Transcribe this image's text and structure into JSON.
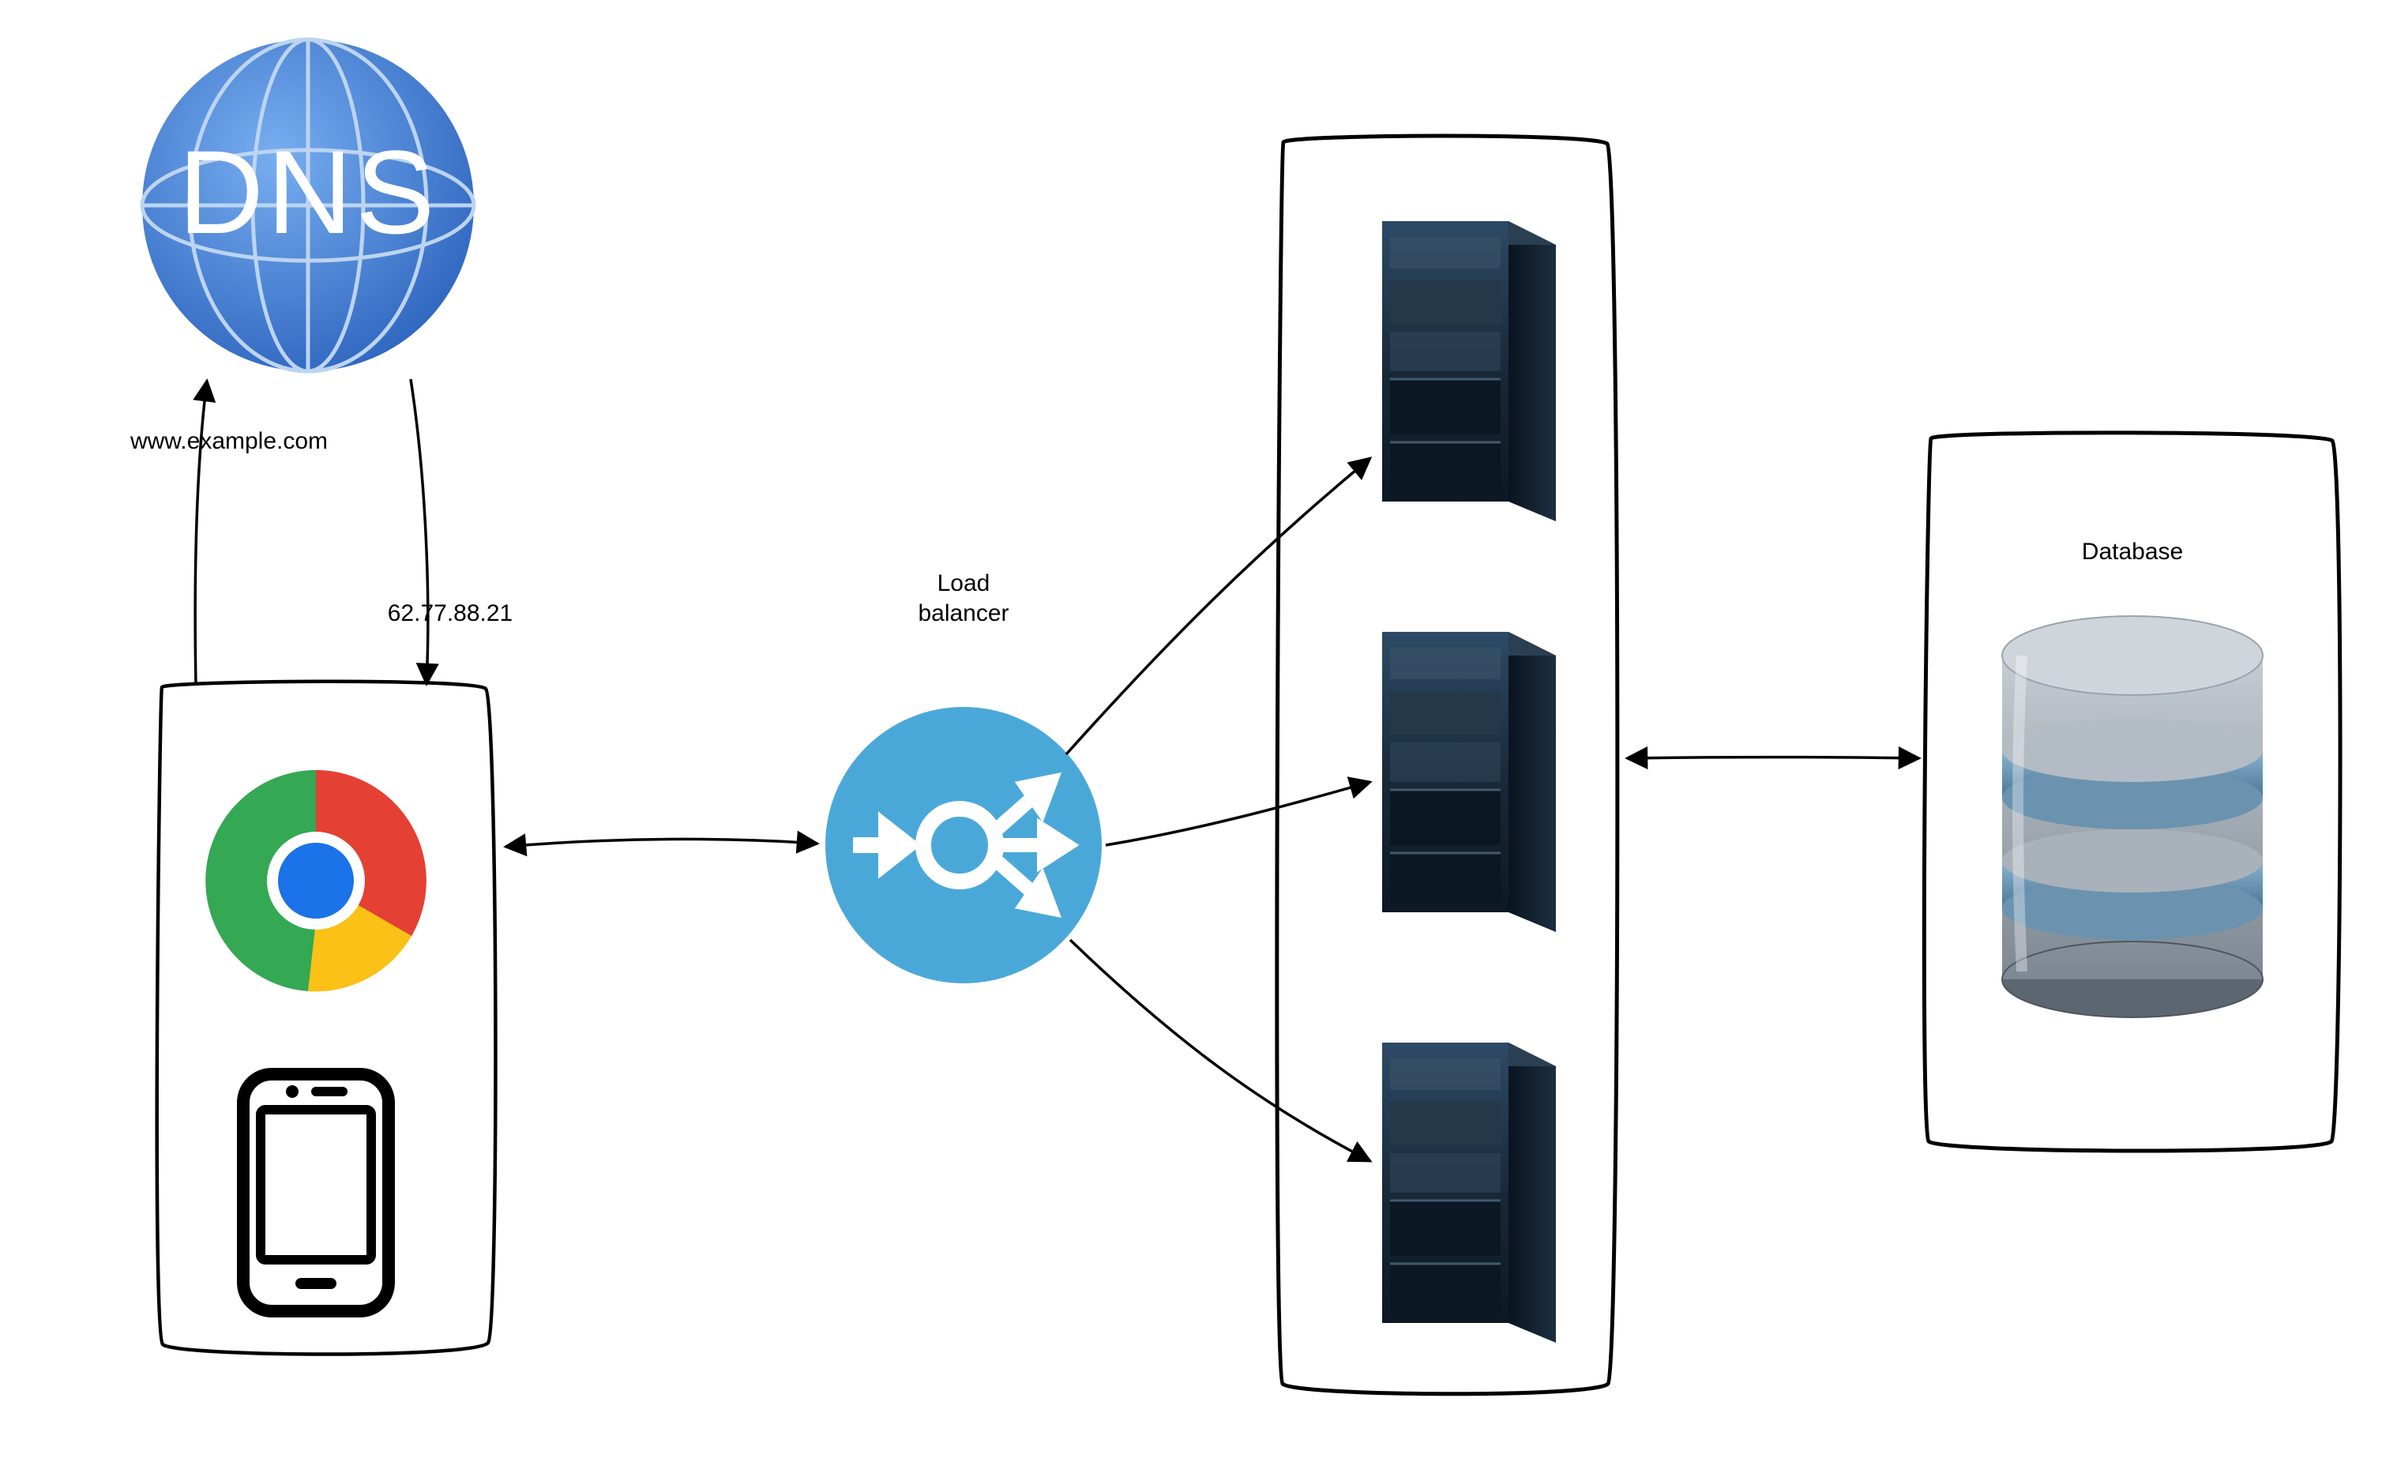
{
  "dns": {
    "badge_text": "DNS"
  },
  "labels": {
    "domain": "www.example.com",
    "ip": "62.77.88.21",
    "load_balancer": "Load\nbalancer",
    "database": "Database"
  },
  "colors": {
    "dns_blue": "#3f7fd9",
    "lb_blue": "#4aa8d8",
    "chrome_red": "#e44034",
    "chrome_yellow": "#fbc116",
    "chrome_green": "#34a853",
    "chrome_blue": "#1a73e8",
    "server_dark": "#1a2a3a",
    "server_mid": "#2d4256",
    "db_grey": "#9aa3ad",
    "db_blue": "#5f8db0"
  }
}
